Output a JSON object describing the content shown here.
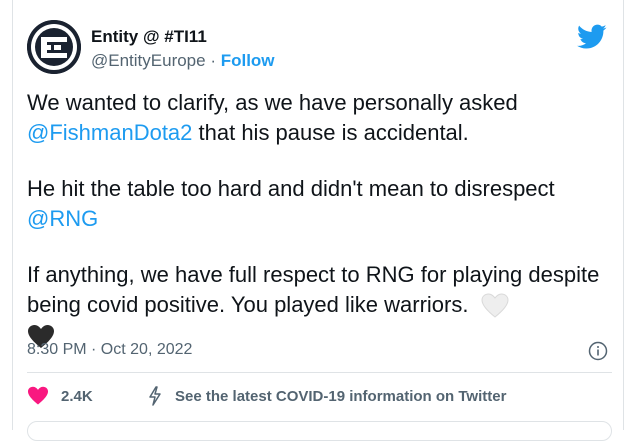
{
  "account": {
    "display_name": "Entity @ #TI11",
    "handle": "@EntityEurope",
    "separator": " · ",
    "follow_label": "Follow",
    "avatar_icon": "entity-logo-icon",
    "platform_icon": "twitter-bird-icon"
  },
  "tweet": {
    "p1_text": "We wanted to clarify, as we have personally asked",
    "p1_mention": "@FishmanDota2",
    "p1_rest": " that his pause is accidental.",
    "p2_text": "He hit the table too hard and didn't mean to disrespect",
    "p2_mention": "@RNG",
    "p3_text": "If anything, we have full respect to RNG for playing despite being covid positive. You played like warriors.",
    "emoji_1": "white-heart-icon",
    "emoji_2": "black-heart-icon"
  },
  "meta": {
    "timestamp": "8:30 PM · Oct 20, 2022",
    "info_icon": "info-icon"
  },
  "actions": {
    "like_count": "2.4K",
    "like_icon": "heart-icon",
    "covid_label": "See the latest COVID-19 information on Twitter",
    "covid_icon": "lightning-icon"
  },
  "colors": {
    "accent": "#1d9bf0",
    "heart": "#f91880",
    "text": "#0f1419",
    "secondary": "#536471"
  }
}
